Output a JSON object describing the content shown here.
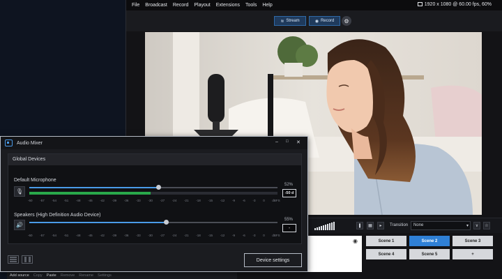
{
  "menubar": {
    "items": [
      "File",
      "Broadcast",
      "Record",
      "Playout",
      "Extensions",
      "Tools",
      "Help"
    ],
    "resolution": "1920 x 1080 @ 60.00 fps, 60%"
  },
  "toolbar": {
    "stream_label": "Stream",
    "record_label": "Record",
    "settings_icon": "gear-icon"
  },
  "transition": {
    "label": "Transition",
    "selected": "None"
  },
  "scenes": [
    "Scene 1",
    "Scene 2",
    "Scene 3",
    "Scene 4",
    "Scene 5",
    "+"
  ],
  "active_scene": "Scene 2",
  "sources_bar": {
    "items": [
      "Add source",
      "Copy",
      "Paste",
      "Remove",
      "Rename",
      "Settings"
    ]
  },
  "mixer": {
    "title": "Audio Mixer",
    "section": "Global Devices",
    "scale": [
      "-60",
      "-57",
      "-54",
      "-51",
      "-48",
      "-45",
      "-42",
      "-39",
      "-36",
      "-33",
      "-30",
      "-27",
      "-24",
      "-21",
      "-18",
      "-15",
      "-12",
      "-9",
      "-6",
      "-3",
      "0",
      "dBFS"
    ],
    "devices": [
      {
        "name": "Default Microphone",
        "volume_pct": "52%",
        "db": "-50 d",
        "volume": 0.52,
        "level": 0.49,
        "icon": "microphone-icon"
      },
      {
        "name": "Speakers (High Definition Audio Device)",
        "volume_pct": "55%",
        "db": "-",
        "volume": 0.55,
        "level": 0,
        "icon": "speaker-icon"
      }
    ],
    "device_settings_label": "Device settings"
  }
}
